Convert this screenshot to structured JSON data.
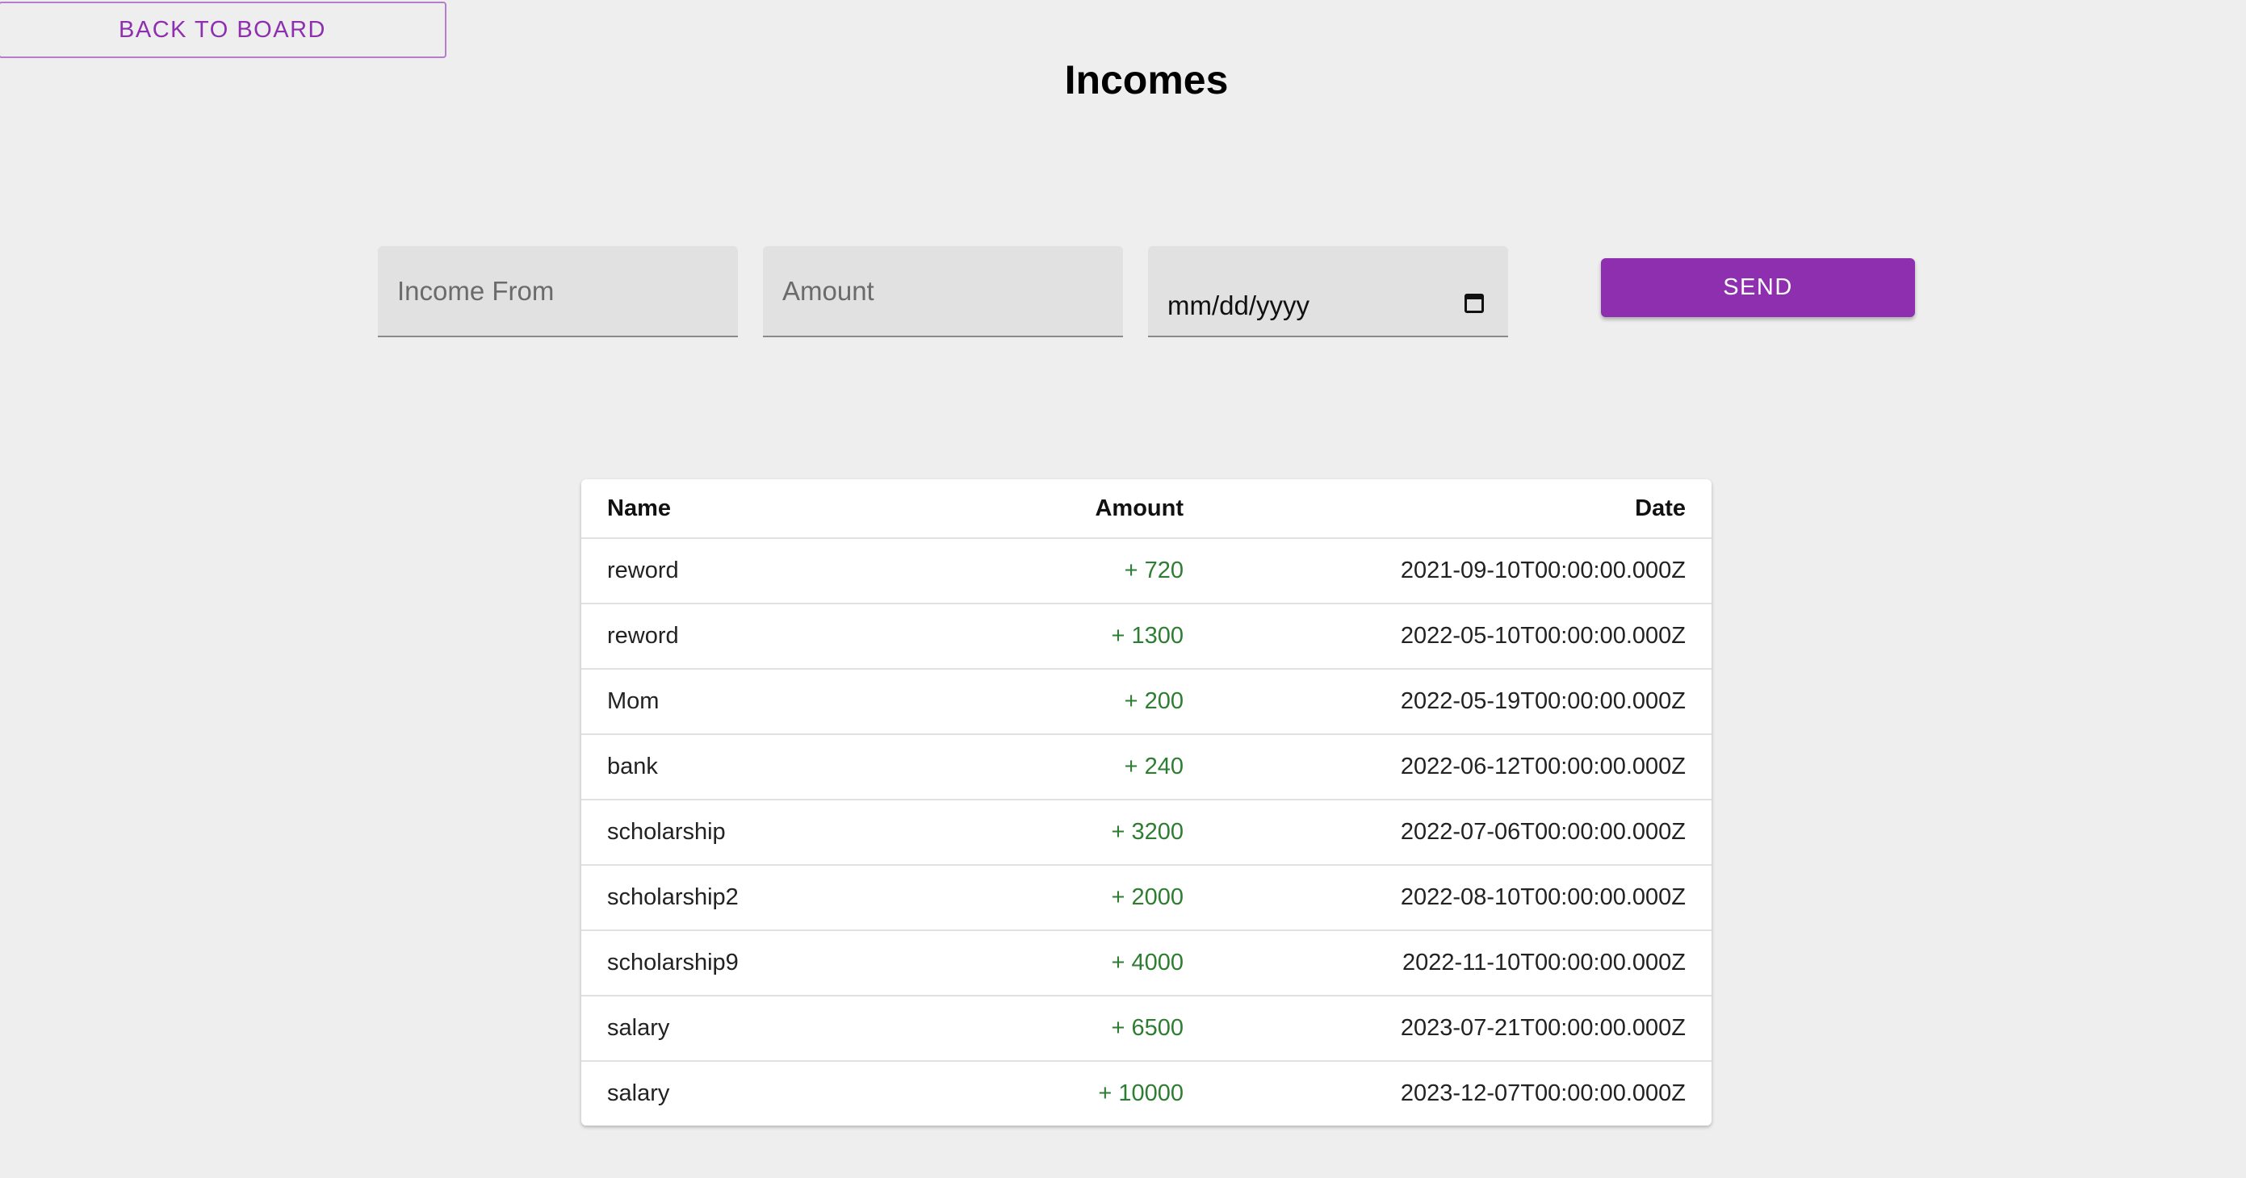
{
  "header": {
    "back_label": "BACK TO BOARD",
    "title": "Incomes"
  },
  "form": {
    "income_from_placeholder": "Income From",
    "amount_placeholder": "Amount",
    "date_placeholder": "mm/dd/yyyy",
    "send_label": "SEND"
  },
  "table": {
    "columns": [
      "Name",
      "Amount",
      "Date"
    ],
    "rows": [
      {
        "name": "reword",
        "amount": "+ 720",
        "date": "2021-09-10T00:00:00.000Z"
      },
      {
        "name": "reword",
        "amount": "+ 1300",
        "date": "2022-05-10T00:00:00.000Z"
      },
      {
        "name": "Mom",
        "amount": "+ 200",
        "date": "2022-05-19T00:00:00.000Z"
      },
      {
        "name": "bank",
        "amount": "+ 240",
        "date": "2022-06-12T00:00:00.000Z"
      },
      {
        "name": "scholarship",
        "amount": "+ 3200",
        "date": "2022-07-06T00:00:00.000Z"
      },
      {
        "name": "scholarship2",
        "amount": "+ 2000",
        "date": "2022-08-10T00:00:00.000Z"
      },
      {
        "name": "scholarship9",
        "amount": "+ 4000",
        "date": "2022-11-10T00:00:00.000Z"
      },
      {
        "name": "salary",
        "amount": "+ 6500",
        "date": "2023-07-21T00:00:00.000Z"
      },
      {
        "name": "salary",
        "amount": "+ 10000",
        "date": "2023-12-07T00:00:00.000Z"
      }
    ]
  },
  "colors": {
    "accent": "#8e2fb0",
    "positive_amount": "#2e7d32",
    "background": "#eeeeee"
  },
  "icons": {
    "date_picker": "calendar-icon"
  }
}
